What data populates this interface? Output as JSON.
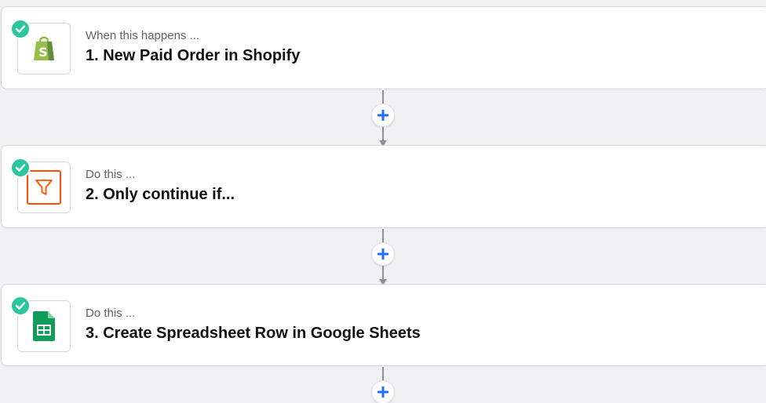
{
  "colors": {
    "background": "#f1f1f3",
    "card": "#ffffff",
    "check": "#2bc5a0",
    "plus": "#1f6ff5",
    "connector": "#8e8e96",
    "shopify_green": "#95bf47",
    "filter_orange": "#ff4f00",
    "sheets_green": "#0f9d58"
  },
  "steps": [
    {
      "kicker": "When this happens ...",
      "title": "1. New Paid Order in Shopify",
      "icon": "shopify-icon",
      "status_icon": "check-icon"
    },
    {
      "kicker": "Do this ...",
      "title": "2. Only continue if...",
      "icon": "filter-icon",
      "status_icon": "check-icon"
    },
    {
      "kicker": "Do this ...",
      "title": "3. Create Spreadsheet Row in Google Sheets",
      "icon": "google-sheets-icon",
      "status_icon": "check-icon"
    }
  ],
  "add_buttons": [
    {
      "icon": "plus-icon"
    },
    {
      "icon": "plus-icon"
    },
    {
      "icon": "plus-icon"
    }
  ]
}
